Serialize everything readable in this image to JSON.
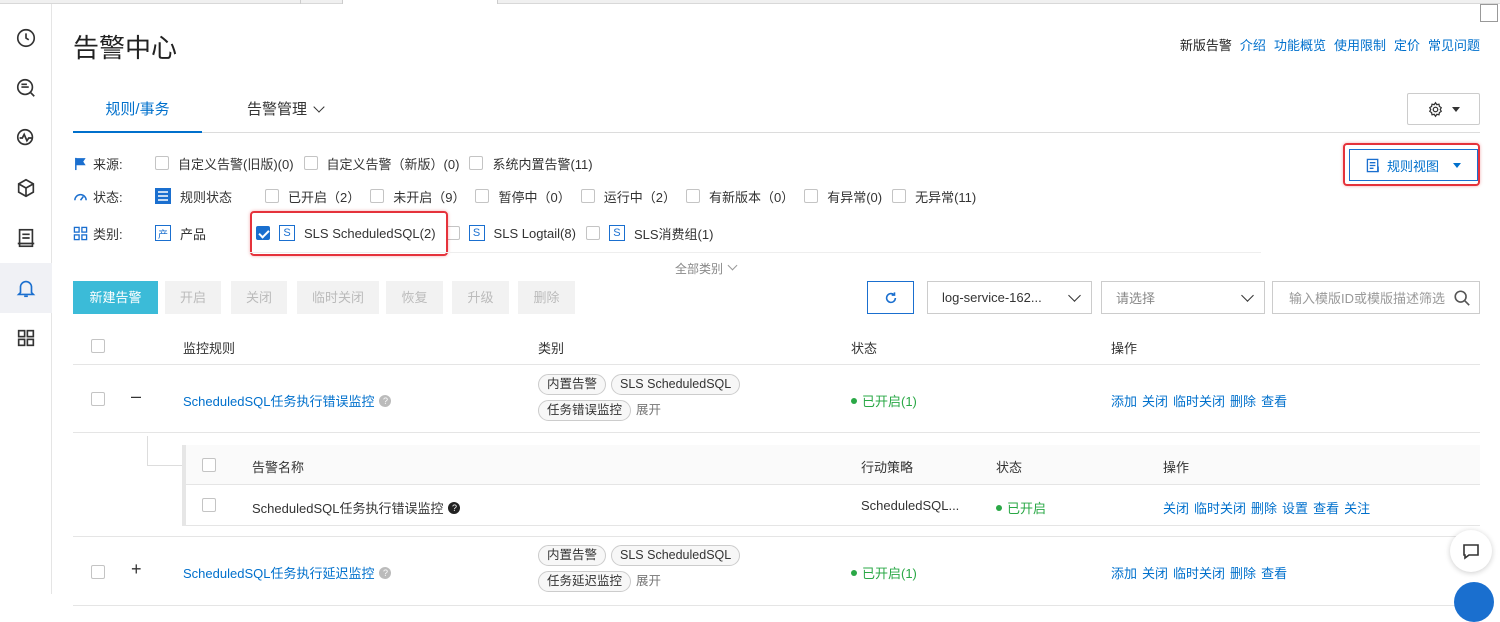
{
  "page": {
    "title": "告警中心",
    "top_links": {
      "new_alert": "新版告警",
      "intro": "介绍",
      "overview": "功能概览",
      "limits": "使用限制",
      "pricing": "定价",
      "faq": "常见问题"
    }
  },
  "nav_icons": [
    "clock-icon",
    "search-chat-icon",
    "monitor-icon",
    "cube-icon",
    "document-icon",
    "bell-icon",
    "grid-icon"
  ],
  "tabs": {
    "rules": "规则/事务",
    "management": "告警管理"
  },
  "filters": {
    "source": {
      "label": "来源:",
      "options": [
        {
          "label": "自定义告警(旧版)(0)",
          "checked": false
        },
        {
          "label": "自定义告警（新版）(0)",
          "checked": false
        },
        {
          "label": "系统内置告警(11)",
          "checked": false
        }
      ]
    },
    "status": {
      "label": "状态:",
      "group": "规则状态",
      "options": [
        {
          "label": "已开启（2）",
          "checked": false
        },
        {
          "label": "未开启（9）",
          "checked": false
        },
        {
          "label": "暂停中（0）",
          "checked": false
        },
        {
          "label": "运行中（2）",
          "checked": false
        },
        {
          "label": "有新版本（0）",
          "checked": false
        },
        {
          "label": "有异常(0)",
          "checked": false
        },
        {
          "label": "无异常(11)",
          "checked": false
        }
      ]
    },
    "category": {
      "label": "类别:",
      "group": "产品",
      "options": [
        {
          "badge": "S",
          "label": "SLS ScheduledSQL(2)",
          "checked": true
        },
        {
          "badge": "S",
          "label": "SLS Logtail(8)",
          "checked": false
        },
        {
          "badge": "S",
          "label": "SLS消费组(1)",
          "checked": false
        }
      ],
      "all": "全部类别"
    }
  },
  "view_button": "规则视图",
  "toolbar": {
    "new": "新建告警",
    "enable": "开启",
    "disable": "关闭",
    "temp_disable": "临时关闭",
    "restore": "恢复",
    "upgrade": "升级",
    "delete": "删除",
    "project_select": "log-service-162...",
    "second_select_placeholder": "请选择",
    "search_placeholder": "输入模版ID或模版描述筛选"
  },
  "table": {
    "headers": {
      "rule": "监控规则",
      "category": "类别",
      "status": "状态",
      "actions": "操作"
    },
    "rows": [
      {
        "expander": "–",
        "name": "ScheduledSQL任务执行错误监控",
        "tags": [
          "内置告警",
          "SLS ScheduledSQL",
          "任务错误监控"
        ],
        "expand": "展开",
        "status": "已开启(1)",
        "actions": [
          "添加",
          "关闭",
          "临时关闭",
          "删除",
          "查看"
        ]
      },
      {
        "expander": "+",
        "name": "ScheduledSQL任务执行延迟监控",
        "tags": [
          "内置告警",
          "SLS ScheduledSQL",
          "任务延迟监控"
        ],
        "expand": "展开",
        "status": "已开启(1)",
        "actions": [
          "添加",
          "关闭",
          "临时关闭",
          "删除",
          "查看"
        ]
      }
    ],
    "sub": {
      "headers": {
        "name": "告警名称",
        "policy": "行动策略",
        "status": "状态",
        "actions": "操作"
      },
      "row": {
        "name": "ScheduledSQL任务执行错误监控",
        "policy": "ScheduledSQL...",
        "status": "已开启",
        "actions": [
          "关闭",
          "临时关闭",
          "删除",
          "设置",
          "查看",
          "关注"
        ]
      }
    }
  },
  "colors": {
    "accent": "#0070cc",
    "primary_button": "#3bbbd8",
    "status_on": "#2aa846",
    "highlight": "#e5323b"
  }
}
